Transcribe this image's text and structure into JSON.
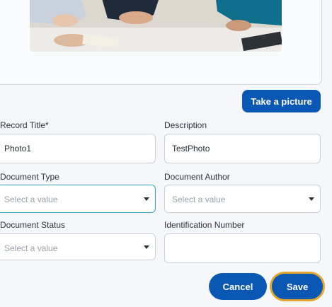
{
  "buttons": {
    "take_picture": "Take a picture",
    "cancel": "Cancel",
    "save": "Save"
  },
  "form": {
    "record_title": {
      "label": "Record Title*",
      "value": "Photo1"
    },
    "description": {
      "label": "Description",
      "value": "TestPhoto"
    },
    "document_type": {
      "label": "Document Type",
      "placeholder": "Select a value"
    },
    "document_author": {
      "label": "Document Author",
      "placeholder": "Select a value"
    },
    "document_status": {
      "label": "Document Status",
      "placeholder": "Select a value"
    },
    "identification_number": {
      "label": "Identification Number",
      "value": ""
    }
  },
  "colors": {
    "primary_button": "#0b57b4",
    "focus_ring": "#e3a52b",
    "focused_field_border": "#32a7c8"
  }
}
